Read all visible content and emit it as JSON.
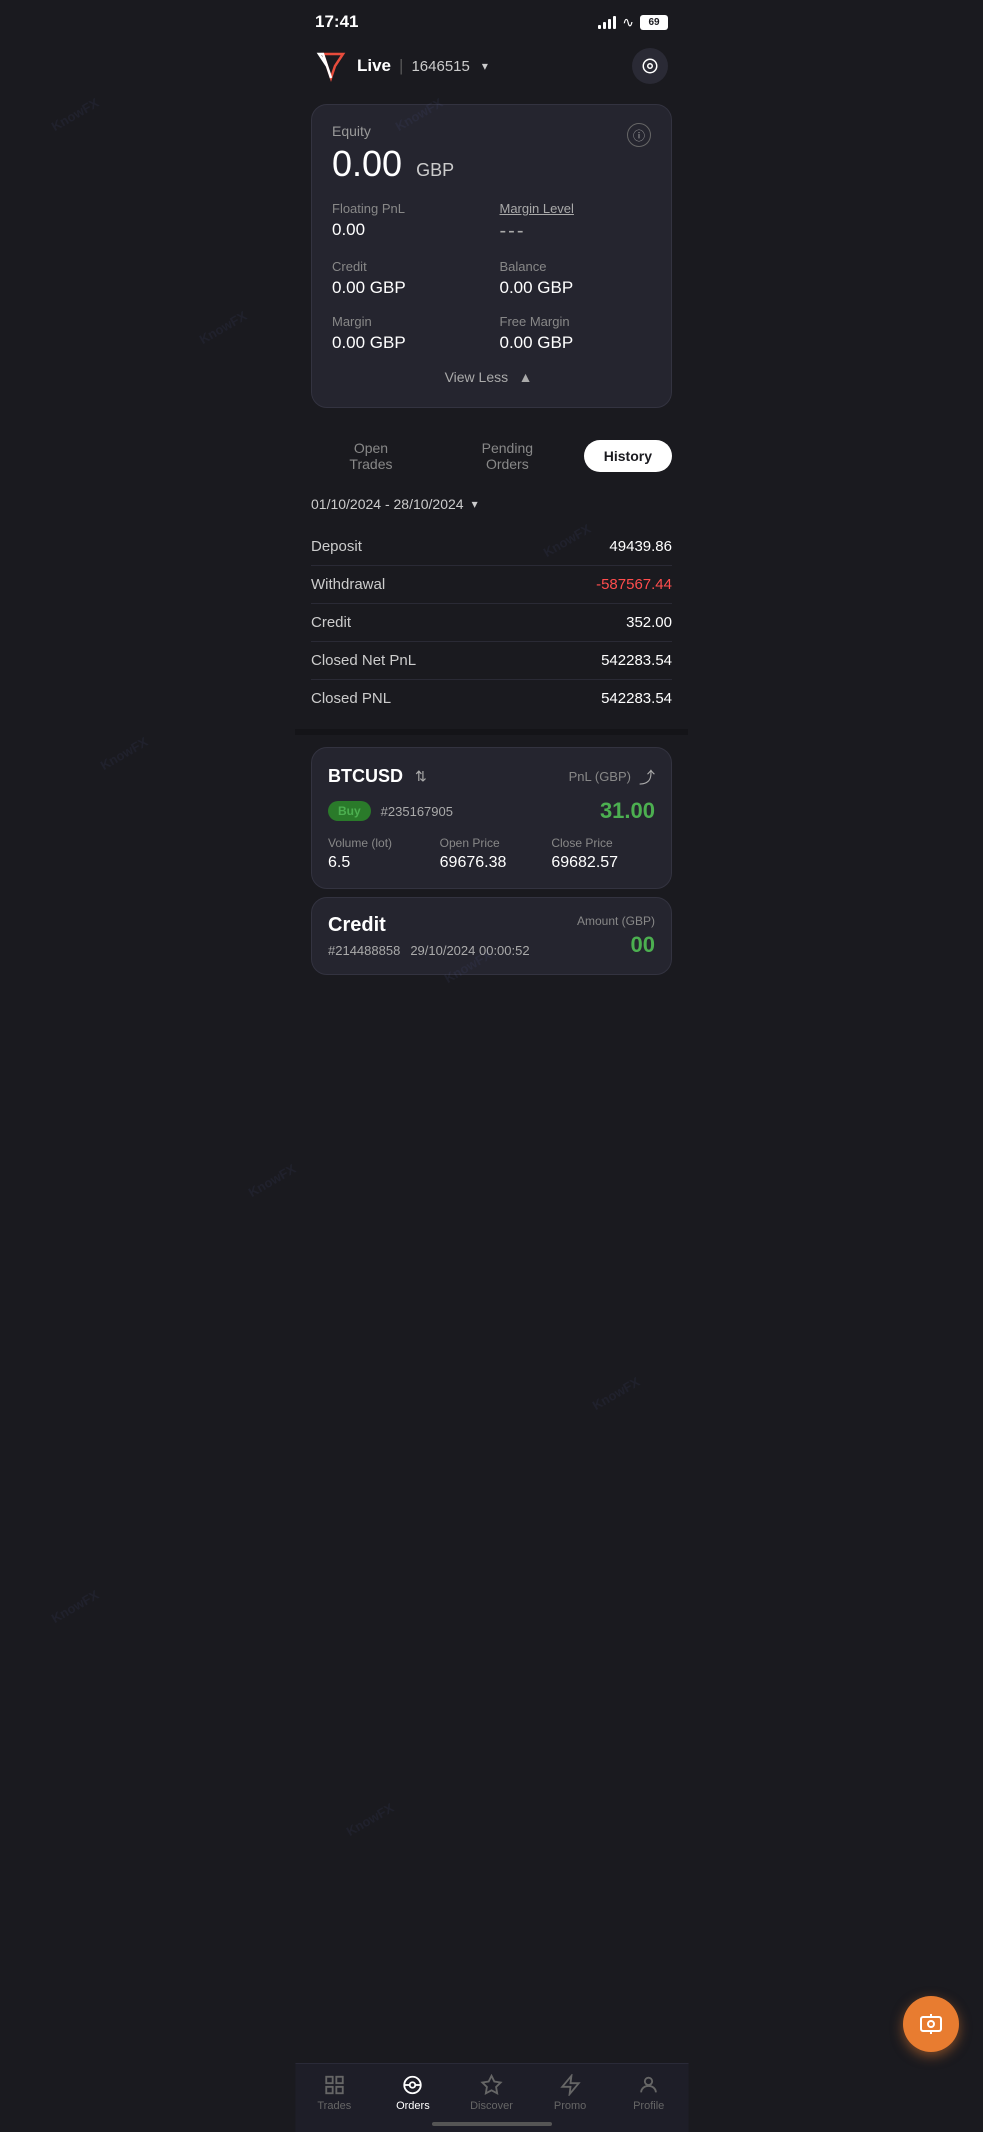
{
  "statusBar": {
    "time": "17:41",
    "battery": "69"
  },
  "header": {
    "mode": "Live",
    "accountId": "1646515",
    "settingsIcon": "⬤"
  },
  "equityCard": {
    "equityLabel": "Equity",
    "equityValue": "0.00",
    "equityCurrency": "GBP",
    "floatingPnlLabel": "Floating PnL",
    "floatingPnlValue": "0.00",
    "marginLevelLabel": "Margin Level",
    "marginLevelValue": "---",
    "creditLabel": "Credit",
    "creditValue": "0.00 GBP",
    "balanceLabel": "Balance",
    "balanceValue": "0.00 GBP",
    "marginLabel": "Margin",
    "marginValue": "0.00 GBP",
    "freeMarginLabel": "Free Margin",
    "freeMarginValue": "0.00 GBP",
    "viewLessLabel": "View Less"
  },
  "tabs": {
    "openTrades": "Open Trades",
    "pendingOrders": "Pending Orders",
    "history": "History"
  },
  "dateRange": {
    "text": "01/10/2024 - 28/10/2024"
  },
  "historyStats": [
    {
      "label": "Deposit",
      "value": "49439.86",
      "negative": false
    },
    {
      "label": "Withdrawal",
      "value": "-587567.44",
      "negative": true
    },
    {
      "label": "Credit",
      "value": "352.00",
      "negative": false
    },
    {
      "label": "Closed Net PnL",
      "value": "542283.54",
      "negative": false
    },
    {
      "label": "Closed PNL",
      "value": "542283.54",
      "negative": false
    }
  ],
  "tradeCard": {
    "symbol": "BTCUSD",
    "symbolIconLabel": "⇅",
    "pnlCurrencyLabel": "PnL (GBP)",
    "direction": "Buy",
    "orderId": "#235167905",
    "pnlValue": "31.00",
    "volumeLabel": "Volume (lot)",
    "volumeValue": "6.5",
    "openPriceLabel": "Open Price",
    "openPriceValue": "69676.38",
    "closePriceLabel": "Close Price",
    "closePriceValue": "69682.57"
  },
  "creditCard": {
    "title": "Credit",
    "orderId": "#214488858",
    "date": "29/10/2024 00:00:52",
    "amountLabel": "Amount (GBP)",
    "amountValue": "00"
  },
  "bottomNav": [
    {
      "id": "trades",
      "label": "Trades",
      "icon": "📊",
      "active": false
    },
    {
      "id": "orders",
      "label": "Orders",
      "icon": "◎",
      "active": true
    },
    {
      "id": "discover",
      "label": "Discover",
      "icon": "◇",
      "active": false
    },
    {
      "id": "promo",
      "label": "Promo",
      "icon": "⚡",
      "active": false
    },
    {
      "id": "profile",
      "label": "Profile",
      "icon": "👤",
      "active": false
    }
  ]
}
